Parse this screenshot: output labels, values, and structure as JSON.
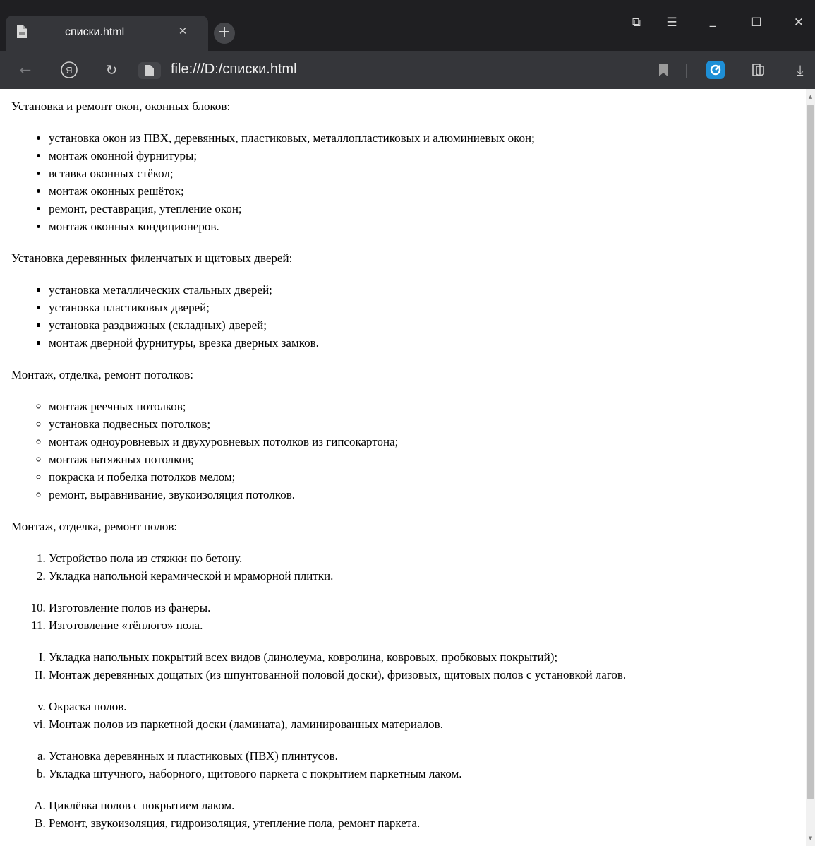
{
  "tab": {
    "title": "списки.html",
    "close_glyph": "✕",
    "favicon": "document-icon"
  },
  "new_tab_glyph": "+",
  "window_controls": {
    "tablet_mode_glyph": "⧉",
    "menu_glyph": "☰",
    "minimize_glyph": "_",
    "maximize_glyph": "☐",
    "close_glyph": "✕"
  },
  "toolbar": {
    "back_glyph": "←",
    "yandex_glyph": "Я",
    "reload_glyph": "↻",
    "address": "file:///D:/списки.html",
    "download_glyph": "⤓"
  },
  "colors": {
    "titlebar": "#1f1f22",
    "toolbar": "#35363a",
    "extension_accent": "#1e8fd6"
  },
  "page": {
    "windows_heading": "Установка и ремонт окон, оконных блоков:",
    "windows_items": [
      "установка окон из ПВХ, деревянных, пластиковых, металлопластиковых и алюминиевых окон;",
      "монтаж оконной фурнитуры;",
      "вставка оконных стёкол;",
      "монтаж оконных решёток;",
      "ремонт, реставрация, утепление окон;",
      "монтаж оконных кондиционеров."
    ],
    "doors_heading": "Установка деревянных филенчатых и щитовых дверей:",
    "doors_items": [
      "установка металлических стальных дверей;",
      "установка пластиковых дверей;",
      "установка раздвижных (складных) дверей;",
      "монтаж дверной фурнитуры, врезка дверных замков."
    ],
    "ceilings_heading": "Монтаж, отделка, ремонт потолков:",
    "ceilings_items": [
      "монтаж реечных потолков;",
      "установка подвесных потолков;",
      "монтаж одноуровневых и двухуровневых потолков из гипсокартона;",
      "монтаж натяжных потолков;",
      "покраска и побелка потолков мелом;",
      "ремонт, выравнивание, звукоизоляция потолков."
    ],
    "floors_heading": "Монтаж, отделка, ремонт полов:",
    "floors_lists": [
      {
        "style": "decimal",
        "start": 1,
        "items": [
          "Устройство пола из стяжки по бетону.",
          "Укладка напольной керамической и мраморной плитки."
        ]
      },
      {
        "style": "decimal",
        "start": 10,
        "items": [
          "Изготовление полов из фанеры.",
          "Изготовление «тёплого» пола."
        ]
      },
      {
        "style": "upper-roman",
        "start": 1,
        "items": [
          "Укладка напольных покрытий всех видов (линолеума, ковролина, ковровых, пробковых покрытий);",
          "Монтаж деревянных дощатых (из шпунтованной половой доски), фризовых, щитовых полов с установкой лагов."
        ]
      },
      {
        "style": "lower-roman",
        "start": 5,
        "items": [
          "Окраска полов.",
          "Монтаж полов из паркетной доски (ламината), ламинированных материалов."
        ]
      },
      {
        "style": "lower-alpha",
        "start": 1,
        "items": [
          "Установка деревянных и пластиковых (ПВХ) плинтусов.",
          "Укладка штучного, наборного, щитового паркета с покрытием паркетным лаком."
        ]
      },
      {
        "style": "upper-alpha",
        "start": 1,
        "items": [
          "Циклёвка полов с покрытием лаком.",
          "Ремонт, звукоизоляция, гидроизоляция, утепление пола, ремонт паркета."
        ]
      }
    ]
  }
}
